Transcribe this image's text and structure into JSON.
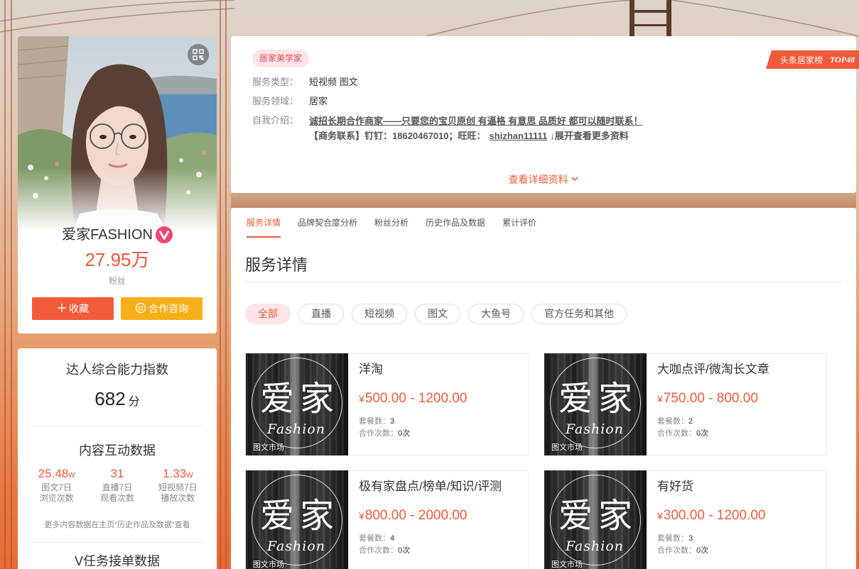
{
  "colors": {
    "accent": "#ec5b39",
    "collect_button": "#f25a3a",
    "consult_button": "#f8b01a",
    "tag_bg": "#fde4e6",
    "tag_text": "#e4475b",
    "ribbon": "#f05a3a",
    "verified": "#f0476d"
  },
  "icons": {
    "qr": "qr-code-icon",
    "verified": "verified-v-icon",
    "collect": "plus-icon",
    "consult": "consult-chat-icon",
    "more": "chevron-down-icon"
  },
  "profile": {
    "name": "爱家FASHION",
    "fans_count": "27.95万",
    "fans_label": "粉丝",
    "collect_label": "收藏",
    "consult_label": "合作咨询"
  },
  "ability": {
    "title": "达人综合能力指数",
    "score": "682",
    "unit": "分"
  },
  "interaction": {
    "title": "内容互动数据",
    "stats": [
      {
        "value": "25.48",
        "unit": "w",
        "label_line1": "图文7日",
        "label_line2": "浏览次数"
      },
      {
        "value": "31",
        "unit": "",
        "label_line1": "直播7日",
        "label_line2": "观看次数"
      },
      {
        "value": "1.33",
        "unit": "w",
        "label_line1": "短视频7日",
        "label_line2": "播放次数"
      }
    ],
    "note": "更多内容数据在主页“历史作品及数据”查看"
  },
  "vtask": {
    "title": "V任务接单数据"
  },
  "info": {
    "tag": "居家美学家",
    "ribbon": {
      "label": "头条居家榜",
      "rank": "TOP48"
    },
    "rows": [
      {
        "label": "服务类型：",
        "value": "短视频 图文"
      },
      {
        "label": "服务领域：",
        "value": "居家"
      }
    ],
    "intro_label": "自我介绍：",
    "intro_line1": "诚招长期合作商家——只要您的宝贝原创 有逼格 有意思 品质好 都可以随时联系！",
    "intro_line2_prefix": "【商务联系】钉钉：18620467010；旺旺：",
    "intro_wangwang": "shizhan11111",
    "intro_expand": "↓展开查看更多资料",
    "more_link": "查看详细资料"
  },
  "tabs": [
    {
      "label": "服务详情",
      "active": true
    },
    {
      "label": "品牌契合度分析",
      "active": false
    },
    {
      "label": "粉丝分析",
      "active": false
    },
    {
      "label": "历史作品及数据",
      "active": false
    },
    {
      "label": "累计评价",
      "active": false
    }
  ],
  "section_title": "服务详情",
  "filters": [
    {
      "label": "全部",
      "active": true
    },
    {
      "label": "直播",
      "active": false
    },
    {
      "label": "短视频",
      "active": false
    },
    {
      "label": "图文",
      "active": false
    },
    {
      "label": "大鱼号",
      "active": false
    },
    {
      "label": "官方任务和其他",
      "active": false
    }
  ],
  "services": {
    "package_label": "套餐数：",
    "orders_label": "合作次数：",
    "items": [
      {
        "title": "洋淘",
        "currency": "¥",
        "price": "500.00 - 1200.00",
        "packages": "3",
        "orders": "0次",
        "badge": "图文市场",
        "logo_text": "爱家",
        "logo_script": "Fashion"
      },
      {
        "title": "大咖点评/微淘长文章",
        "currency": "¥",
        "price": "750.00 - 800.00",
        "packages": "2",
        "orders": "0次",
        "badge": "图文市场",
        "logo_text": "爱家",
        "logo_script": "Fashion"
      },
      {
        "title": "极有家盘点/榜单/知识/评测",
        "currency": "¥",
        "price": "800.00 - 2000.00",
        "packages": "4",
        "orders": "0次",
        "badge": "图文市场",
        "logo_text": "爱家",
        "logo_script": "Fashion"
      },
      {
        "title": "有好货",
        "currency": "¥",
        "price": "300.00 - 1200.00",
        "packages": "3",
        "orders": "0次",
        "badge": "图文市场",
        "logo_text": "爱家",
        "logo_script": "Fashion"
      }
    ]
  }
}
